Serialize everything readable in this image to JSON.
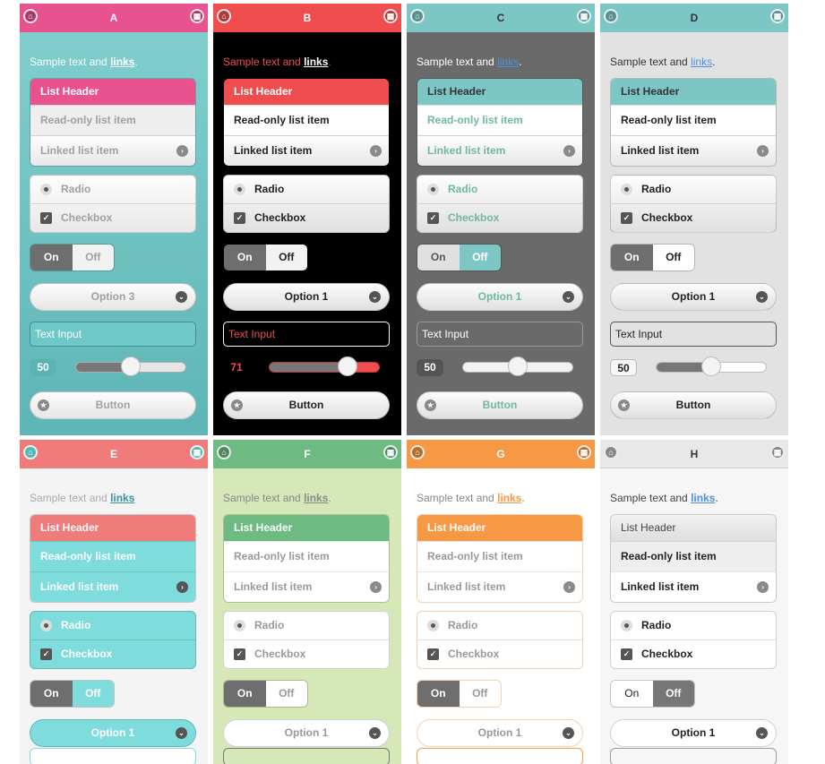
{
  "common": {
    "sample_prefix": "Sample text and ",
    "sample_link": "links",
    "list_header": "List Header",
    "readonly_item": "Read-only list item",
    "linked_item": "Linked list item",
    "radio_label": "Radio",
    "checkbox_label": "Checkbox",
    "on_label": "On",
    "off_label": "Off",
    "text_input": "Text Input",
    "button_label": "Button"
  },
  "themes": [
    {
      "id": "A",
      "select": "Option 3",
      "slider_value": "50",
      "slider_percent": 50,
      "colors": {
        "header": "#e8528e",
        "body": "#6ec8c8",
        "accent": "#e8528e"
      }
    },
    {
      "id": "B",
      "select": "Option 1",
      "slider_value": "71",
      "slider_percent": 71,
      "colors": {
        "header": "#f04e4e",
        "body": "#000000",
        "accent": "#f04e4e"
      }
    },
    {
      "id": "C",
      "select": "Option 1",
      "slider_value": "50",
      "slider_percent": 50,
      "colors": {
        "header": "#7cc6c6",
        "body": "#6a6a6a",
        "accent": "#6fb999"
      }
    },
    {
      "id": "D",
      "select": "Option 1",
      "slider_value": "50",
      "slider_percent": 50,
      "colors": {
        "header": "#7cc6c6",
        "body": "#e2e2e2",
        "accent": "#7cc6c6"
      }
    },
    {
      "id": "E",
      "select": "Option 1",
      "colors": {
        "header": "#ef7b7b",
        "body": "#f4f4f4",
        "accent": "#7fdcdc"
      }
    },
    {
      "id": "F",
      "select": "Option 1",
      "colors": {
        "header": "#6dbb83",
        "body": "#d6e7b8",
        "accent": "#6dbb83"
      }
    },
    {
      "id": "G",
      "select": "Option 1",
      "colors": {
        "header": "#f79845",
        "body": "#ffffff",
        "accent": "#f79845"
      }
    },
    {
      "id": "H",
      "select": "Option 1",
      "colors": {
        "header": "#e8e8e8",
        "body": "#f6f6f6",
        "accent": "#777777"
      }
    }
  ],
  "icons": {
    "home": "home-icon",
    "grid": "grid-icon",
    "arrow": "arrow-right-icon",
    "chevron": "chevron-down-icon",
    "star": "star-icon"
  }
}
